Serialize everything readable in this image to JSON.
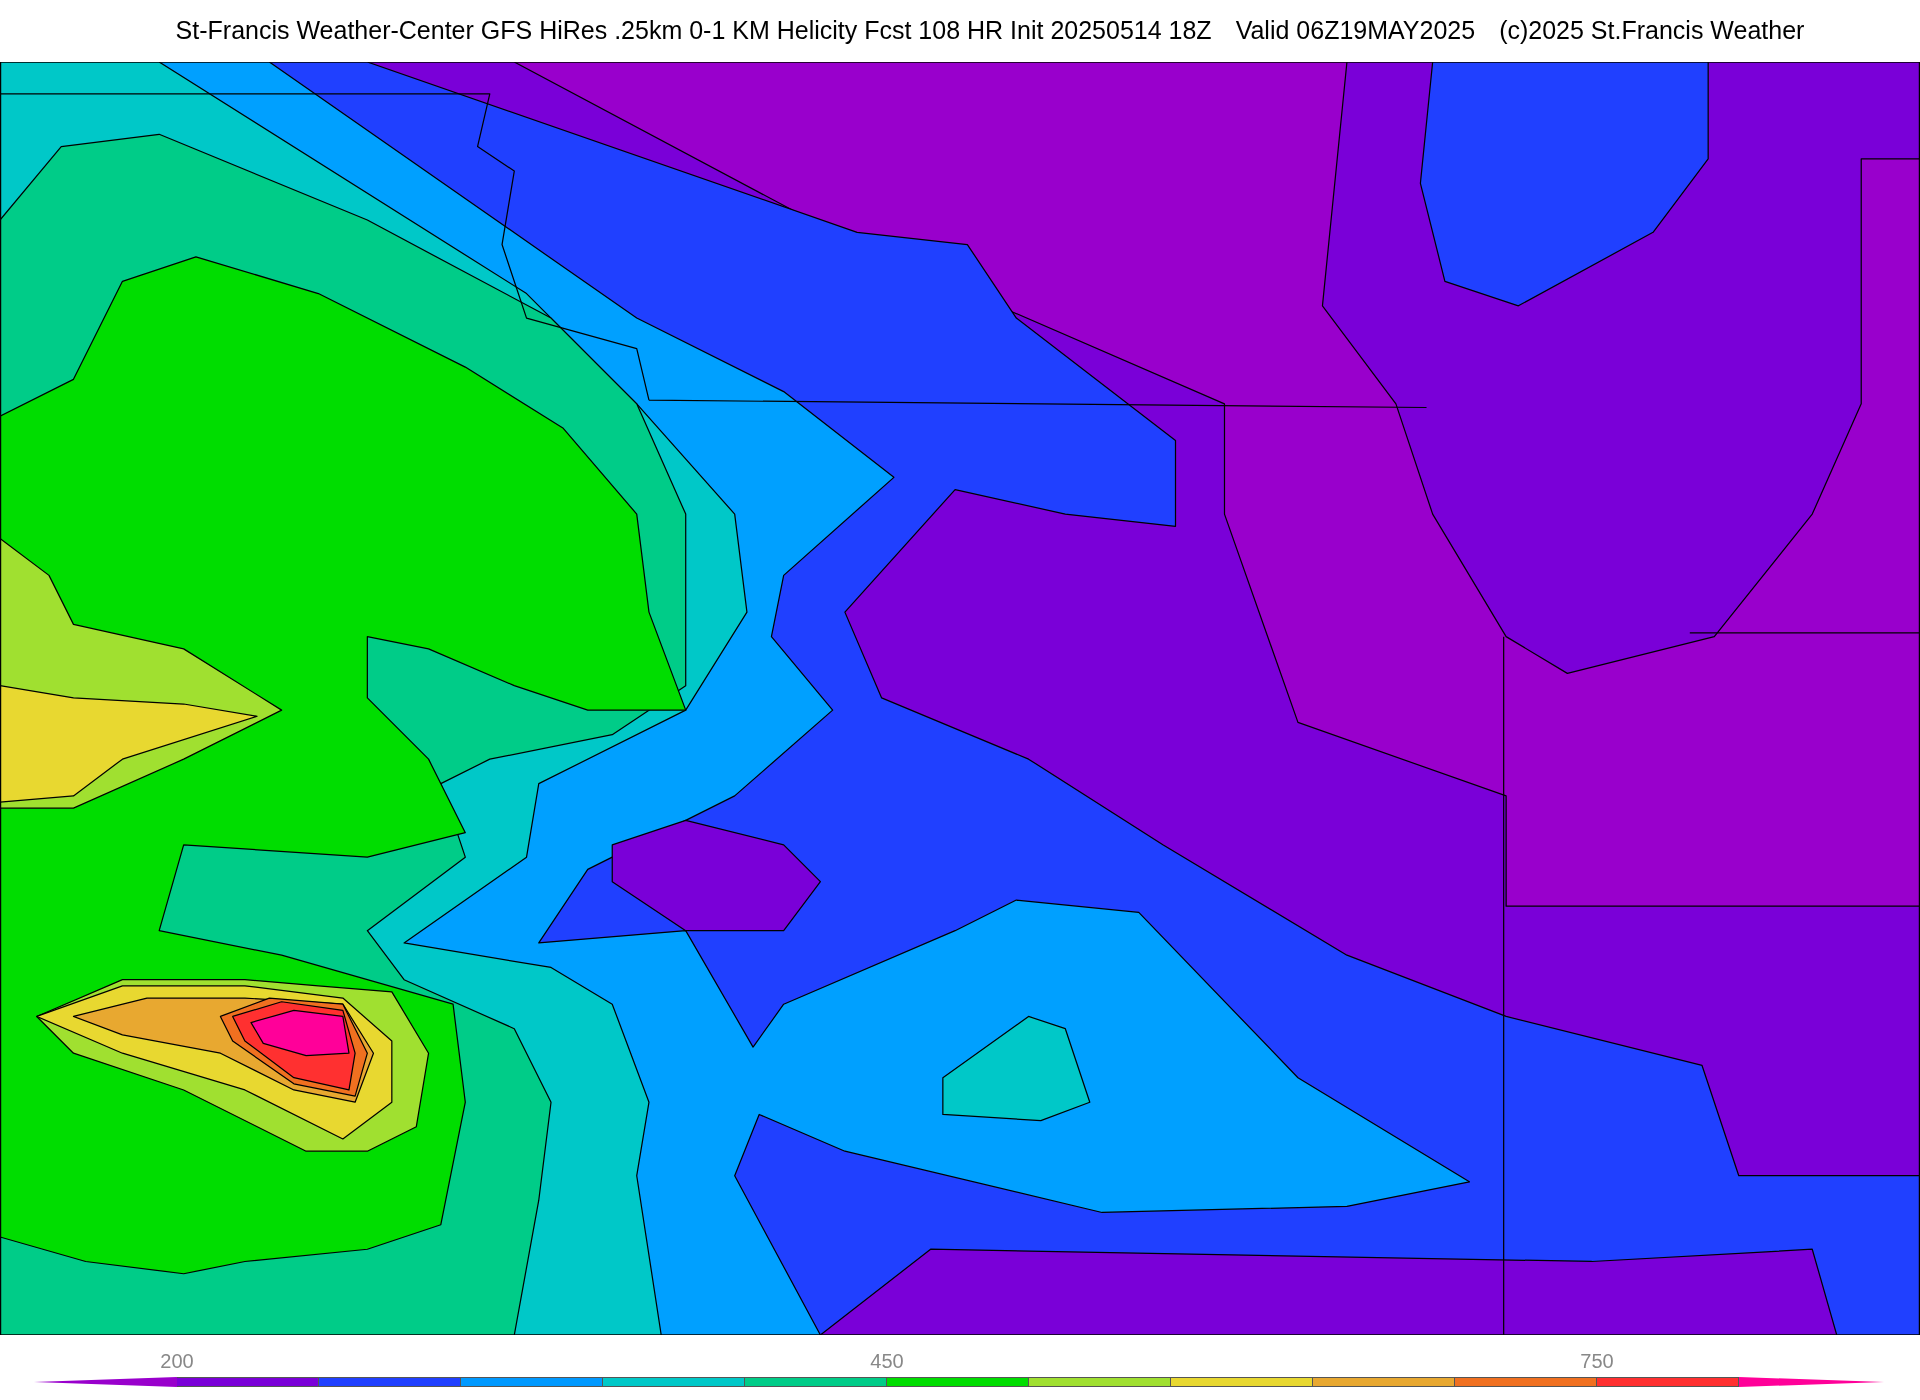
{
  "title_parts": [
    "St-Francis Weather-Center GFS HiRes .25km 0-1 KM Helicity Fcst 108 HR Init 20250514 18Z",
    "Valid 06Z19MAY2025",
    "(c)2025 St.Francis Weather"
  ],
  "colorbar": {
    "segments": [
      {
        "kind": "extend-min",
        "color": "#9900cc"
      },
      {
        "kind": "bin",
        "color": "#7a00d8",
        "label": "200"
      },
      {
        "kind": "bin",
        "color": "#2040ff"
      },
      {
        "kind": "bin",
        "color": "#0099ff"
      },
      {
        "kind": "bin",
        "color": "#00c8c8"
      },
      {
        "kind": "bin",
        "color": "#00cc88"
      },
      {
        "kind": "bin",
        "color": "#00dd00",
        "label": "450"
      },
      {
        "kind": "bin",
        "color": "#a0e030"
      },
      {
        "kind": "bin",
        "color": "#e8d830"
      },
      {
        "kind": "bin",
        "color": "#e8a830"
      },
      {
        "kind": "bin",
        "color": "#f07020"
      },
      {
        "kind": "bin",
        "color": "#ff3030",
        "label": "750"
      },
      {
        "kind": "extend-max",
        "color": "#ff0099"
      }
    ]
  }
}
